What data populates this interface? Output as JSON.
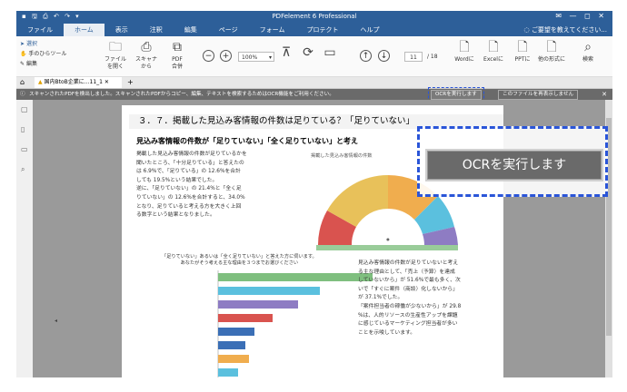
{
  "app": {
    "title": "PDFelement 6 Professional",
    "quick_access": "▪ 🖫 ⎙ ↶ ↷ ▾",
    "window_controls": "✉ — ◻ ✕"
  },
  "menu": {
    "items": [
      "ファイル",
      "ホーム",
      "表示",
      "注釈",
      "編集",
      "ページ",
      "フォーム",
      "プロテクト",
      "ヘルプ"
    ],
    "active": "ホーム",
    "help_text": "ご要望を教えてください..."
  },
  "ribbon": {
    "select": "選択",
    "hand": "手のひらツール",
    "edit": "編集",
    "open_file": "ファイル\nを開く",
    "scanner": "スキャナ\nから",
    "pdf_merge": "PDF\n合併",
    "zoom": "100%",
    "page_current": "11",
    "page_total": "/ 18",
    "to_word": "Wordに",
    "to_excel": "Excelに",
    "to_ppt": "PPTに",
    "to_other": "他の形式に",
    "search": "検索"
  },
  "tab": {
    "name": "国内BtoB企業に...11_1",
    "close": "✕"
  },
  "notice": {
    "text": "スキャンされたPDFを検出しました。スキャンされたPDFからコピー、編集、テキストを検索するためはOCR機能をご利用ください。",
    "ocr_button": "OCRを実行します",
    "reopen_button": "このファイルを再表示しません",
    "callout_label": "OCRを実行します"
  },
  "page": {
    "heading": "３．７．掲載した見込み客情報の件数は足りている？「足りていない」",
    "subhead": "見込み客情報の件数が「足りていない」「全く足りていない」と考え",
    "para1": [
      "掲載した見込み客情報の件数が足りているかを",
      "聞いたところ、「十分足りている」と答えたの",
      "は 6.9%で、「足りている」の 12.6%を合計",
      "しても 19.5%という結果でした。",
      "逆に、「足りていない」の 21.4%と「全く足",
      "りていない」の 12.6%を合計すると、34.0%",
      "となり、足りていると考える方を大きく上回",
      "る数字という結果となりました。"
    ],
    "donut_title": "掲載した見込み客情報の件数",
    "bar_title": "「足りていない」あるいは「全く足りていない」と答えた方に伺います。\nあなたがそう考える主な理由を３つまでお選びください",
    "para2": [
      "見込み客情報の件数が足りていないと考え",
      "る主な理由として、「売上（予算）を達成",
      "していないから」が 51.6%で最も多く、次",
      "いで「すぐに案件（商談）化しないから」",
      "が 37.1%でした。",
      "「案件担当者の稼働が少ないから」が 29.8",
      "%は、人的リソースの生産性アップを課題",
      "に感じているマーケティング担当者が多い",
      "ことを示唆しています。"
    ]
  },
  "chart_data": [
    {
      "type": "pie",
      "title": "掲載した見込み客情報の件数",
      "colors": [
        "#d9534f",
        "#f0ad4e",
        "#e8c15a",
        "#5bc0de",
        "#8e7cc3",
        "#7fbf7f"
      ]
    },
    {
      "type": "bar",
      "orientation": "horizontal",
      "colors": [
        "#7fbf7f",
        "#5bc0de",
        "#8e7cc3",
        "#d9534f",
        "#3b6fb6",
        "#f0ad4e"
      ]
    }
  ]
}
